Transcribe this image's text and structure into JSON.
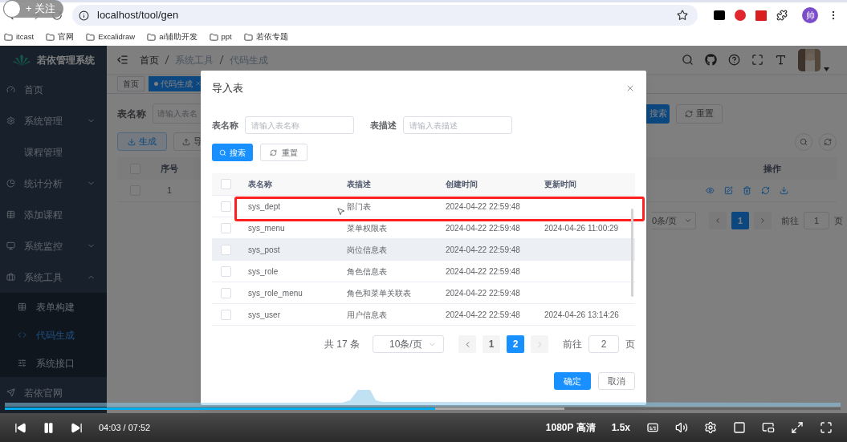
{
  "browser": {
    "url": "localhost/tool/gen",
    "profile": "帅",
    "bookmarks": [
      "itcast",
      "官网",
      "Excalidraw",
      "ai辅助开发",
      "ppt",
      "若依专题"
    ]
  },
  "follow_button": {
    "label": "+ 关注"
  },
  "sidebar": {
    "title": "若依管理系统",
    "items": [
      {
        "label": "首页",
        "kind": "link"
      },
      {
        "label": "系统管理",
        "kind": "group",
        "expanded": false
      },
      {
        "label": "课程管理",
        "kind": "link"
      },
      {
        "label": "统计分析",
        "kind": "group",
        "expanded": false
      },
      {
        "label": "添加课程",
        "kind": "link"
      },
      {
        "label": "系统监控",
        "kind": "group",
        "expanded": false
      },
      {
        "label": "系统工具",
        "kind": "group",
        "expanded": true,
        "children": [
          {
            "label": "表单构建",
            "selected": false
          },
          {
            "label": "代码生成",
            "selected": true
          },
          {
            "label": "系统接口",
            "selected": false
          }
        ]
      },
      {
        "label": "若依官网",
        "kind": "link"
      }
    ]
  },
  "navbar": {
    "breadcrumb": [
      "首页",
      "系统工具",
      "代码生成"
    ]
  },
  "tags": [
    {
      "label": "首页",
      "selected": false
    },
    {
      "label": "代码生成",
      "selected": true
    }
  ],
  "page": {
    "query_label": "表名称",
    "query_placeholder": "请输入表名",
    "search_button": "搜索",
    "reset_button": "重置",
    "toolbar": [
      "生成",
      "导"
    ],
    "select_all_checked": false,
    "columns": [
      "序号",
      "操作"
    ],
    "row_checked": false,
    "row_number": "1",
    "page_size": "0条/页",
    "pages": [
      {
        "label": "1",
        "selected": true
      }
    ],
    "goto": "前往",
    "goto_value": "1",
    "goto_suffix": "页"
  },
  "dialog": {
    "title": "导入表",
    "fields": [
      {
        "label": "表名称",
        "placeholder": "请输入表名称"
      },
      {
        "label": "表描述",
        "placeholder": "请输入表描述"
      }
    ],
    "search_button": "搜索",
    "reset_button": "重置",
    "select_all_checked": false,
    "columns": [
      "表名称",
      "表描述",
      "创建时间",
      "更新时间"
    ],
    "rows": [
      {
        "name": "sys_dept",
        "desc": "部门表",
        "created": "2024-04-22 22:59:48",
        "checked": false,
        "hovered": false,
        "annotated": true
      },
      {
        "name": "sys_menu",
        "desc": "菜单权限表",
        "created": "2024-04-22 22:59:48",
        "updated": "2024-04-26 11:00:29",
        "checked": false,
        "hovered": false,
        "annotated": false
      },
      {
        "name": "sys_post",
        "desc": "岗位信息表",
        "created": "2024-04-22 22:59:48",
        "checked": false,
        "hovered": true,
        "annotated": false
      },
      {
        "name": "sys_role",
        "desc": "角色信息表",
        "created": "2024-04-22 22:59:48",
        "checked": false,
        "hovered": false,
        "annotated": false
      },
      {
        "name": "sys_role_menu",
        "desc": "角色和菜单关联表",
        "created": "2024-04-22 22:59:48",
        "checked": false,
        "hovered": false,
        "annotated": false
      },
      {
        "name": "sys_user",
        "desc": "用户信息表",
        "created": "2024-04-22 22:59:48",
        "updated": "2024-04-26 13:14:26",
        "checked": false,
        "hovered": false,
        "annotated": false
      }
    ],
    "total": "共 17 条",
    "page_size": "10条/页",
    "pages": [
      {
        "label": "1",
        "selected": false
      },
      {
        "label": "2",
        "selected": true
      }
    ],
    "goto": "前往",
    "goto_value": "2",
    "goto_suffix": "页",
    "confirm_button": "确定",
    "cancel_button": "取消"
  },
  "player": {
    "progress": {
      "level": 0.515
    },
    "time": "04:03 / 07:52",
    "quality": "1080P 高清",
    "speed": "1.5x"
  }
}
